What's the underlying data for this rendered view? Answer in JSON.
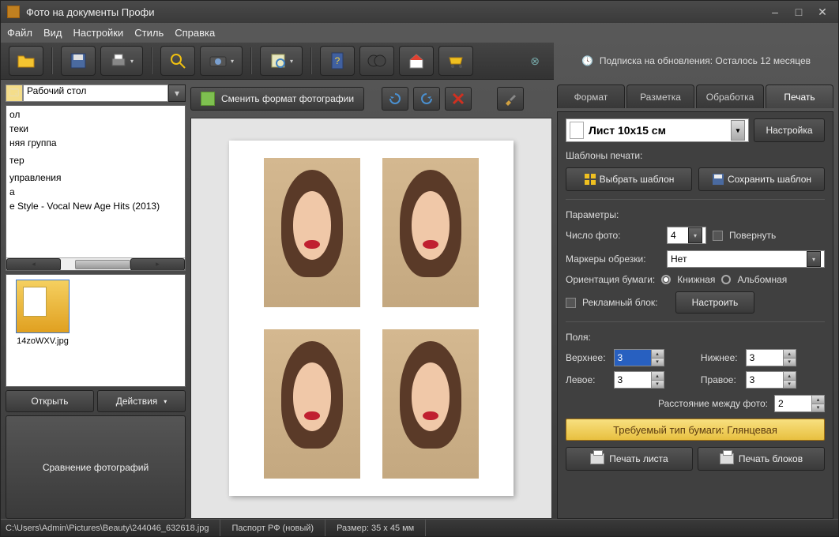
{
  "title": "Фото на документы Профи",
  "menu": [
    "Файл",
    "Вид",
    "Настройки",
    "Стиль",
    "Справка"
  ],
  "subscribe": "Подписка на обновления: Осталось  12 месяцев",
  "left": {
    "folder": "Рабочий стол",
    "items": [
      "ол",
      "теки",
      "няя группа",
      "",
      "тер",
      "",
      "управления",
      "а",
      "e Style - Vocal New Age Hits (2013)"
    ],
    "thumb_name": "14zoWXV.jpg",
    "open": "Открыть",
    "actions": "Действия",
    "compare": "Сравнение фотографий"
  },
  "center": {
    "change_format": "Сменить формат фотографии"
  },
  "tabs": [
    "Формат",
    "Разметка",
    "Обработка",
    "Печать"
  ],
  "print": {
    "paper": "Лист 10x15 см",
    "settings": "Настройка",
    "templates_label": "Шаблоны печати:",
    "choose_template": "Выбрать шаблон",
    "save_template": "Сохранить шаблон",
    "params_label": "Параметры:",
    "count_label": "Число фото:",
    "count": "4",
    "rotate": "Повернуть",
    "crop_label": "Маркеры обрезки:",
    "crop_value": "Нет",
    "orient_label": "Ориентация бумаги:",
    "orient_portrait": "Книжная",
    "orient_landscape": "Альбомная",
    "ad_block": "Рекламный блок:",
    "configure": "Настроить",
    "margins_label": "Поля:",
    "top": "Верхнее:",
    "bottom": "Нижнее:",
    "leftm": "Левое:",
    "rightm": "Правое:",
    "spacing": "Расстояние между фото:",
    "val_top": "3",
    "val_bottom": "3",
    "val_left": "3",
    "val_right": "3",
    "val_spacing": "2",
    "paper_req": "Требуемый тип бумаги: Глянцевая",
    "print_sheet": "Печать листа",
    "print_blocks": "Печать блоков"
  },
  "status": {
    "path": "C:\\Users\\Admin\\Pictures\\Beauty\\244046_632618.jpg",
    "format": "Паспорт РФ (новый)",
    "size": "Размер: 35 x 45 мм"
  }
}
